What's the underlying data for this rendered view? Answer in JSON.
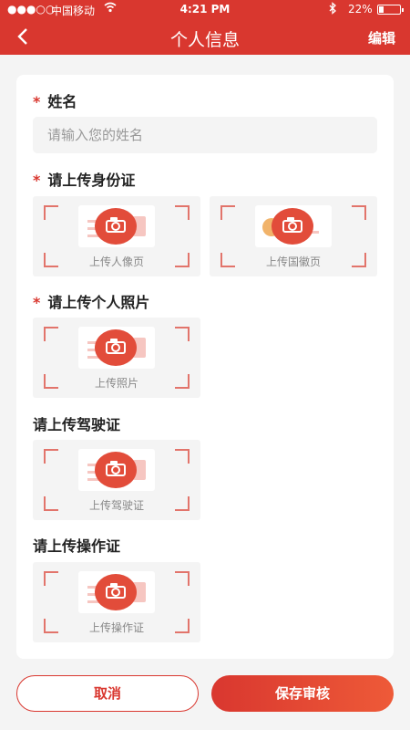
{
  "status_bar": {
    "signal": "●●●○○",
    "carrier": "中国移动",
    "time": "4:21 PM",
    "battery": "22%",
    "battery_level": 0.22
  },
  "nav": {
    "title": "个人信息",
    "edit_label": "编辑"
  },
  "form": {
    "name": {
      "label": "姓名",
      "required": true,
      "placeholder": "请输入您的姓名",
      "value": ""
    },
    "id_card": {
      "label": "请上传身份证",
      "required": true,
      "front_caption": "上传人像页",
      "back_caption": "上传国徽页"
    },
    "photo": {
      "label": "请上传个人照片",
      "required": true,
      "caption": "上传照片"
    },
    "driver_license": {
      "label": "请上传驾驶证",
      "required": false,
      "caption": "上传驾驶证"
    },
    "operation_cert": {
      "label": "请上传操作证",
      "required": false,
      "caption": "上传操作证"
    }
  },
  "actions": {
    "cancel_label": "取消",
    "save_label": "保存审核"
  },
  "colors": {
    "brand": "#d9372f",
    "background": "#f4f4f4"
  }
}
